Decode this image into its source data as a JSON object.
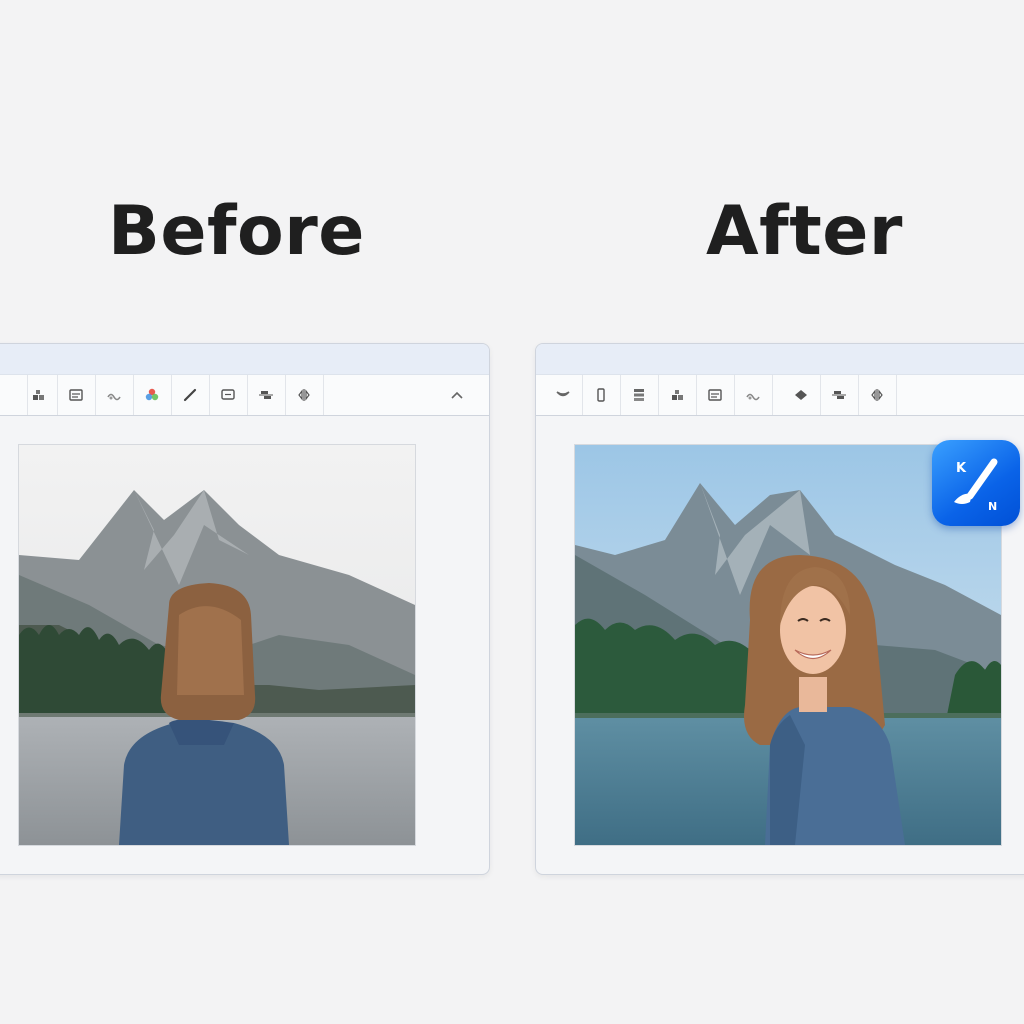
{
  "headings": {
    "before": "Before",
    "after": "After"
  },
  "before_panel": {
    "tools": [
      "shapes-icon",
      "text-box-icon",
      "effects-icon",
      "color-palette-icon",
      "brush-icon",
      "caption-icon",
      "arrange-icon",
      "flip-icon"
    ],
    "collapse_icon": "chevron-up-icon"
  },
  "after_panel": {
    "tools": [
      "heart-icon",
      "phone-icon",
      "layers-icon",
      "shapes-icon",
      "text-box-icon",
      "effects-icon",
      "diamond-icon",
      "arrange-icon",
      "flip-icon"
    ]
  },
  "app_badge": {
    "letter_top": "K",
    "letter_bottom": "N",
    "icon": "brush-icon"
  },
  "colors": {
    "badge": "#0a63e8",
    "heading": "#1f1f1f"
  }
}
